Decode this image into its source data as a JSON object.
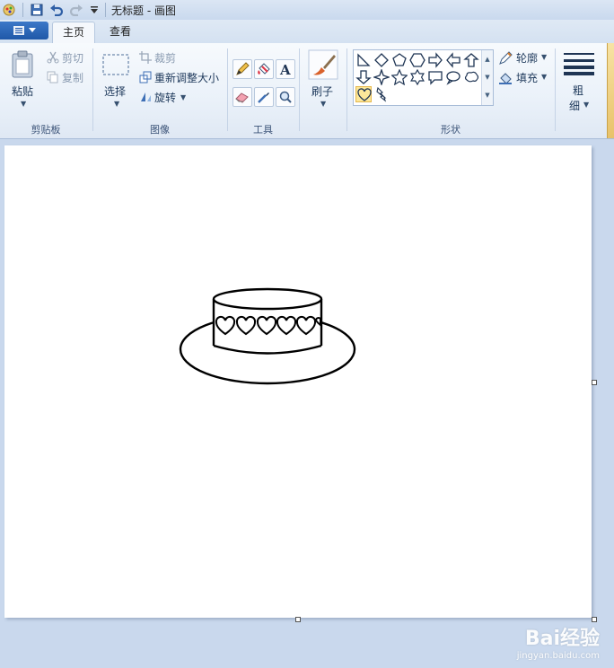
{
  "window": {
    "title": "无标题 - 画图"
  },
  "tabs": [
    {
      "label": "主页",
      "active": true
    },
    {
      "label": "查看",
      "active": false
    }
  ],
  "ribbon": {
    "clipboard": {
      "paste_label": "粘贴",
      "cut_label": "剪切",
      "copy_label": "复制",
      "group_label": "剪贴板"
    },
    "image": {
      "select_label": "选择",
      "crop_label": "裁剪",
      "resize_label": "重新调整大小",
      "rotate_label": "旋转",
      "group_label": "图像"
    },
    "tools": {
      "group_label": "工具"
    },
    "brushes": {
      "label": "刷子"
    },
    "shapes": {
      "outline_label": "轮廓",
      "fill_label": "填充",
      "group_label": "形状"
    },
    "size": {
      "label_line1": "粗",
      "label_line2": "细"
    }
  },
  "watermark": {
    "brand": "Bai经验",
    "url": "jingyan.baidu.com"
  },
  "colors": {
    "accent": "#1f58a8",
    "canvas": "#ffffff",
    "workspace": "#c9d8ed"
  }
}
